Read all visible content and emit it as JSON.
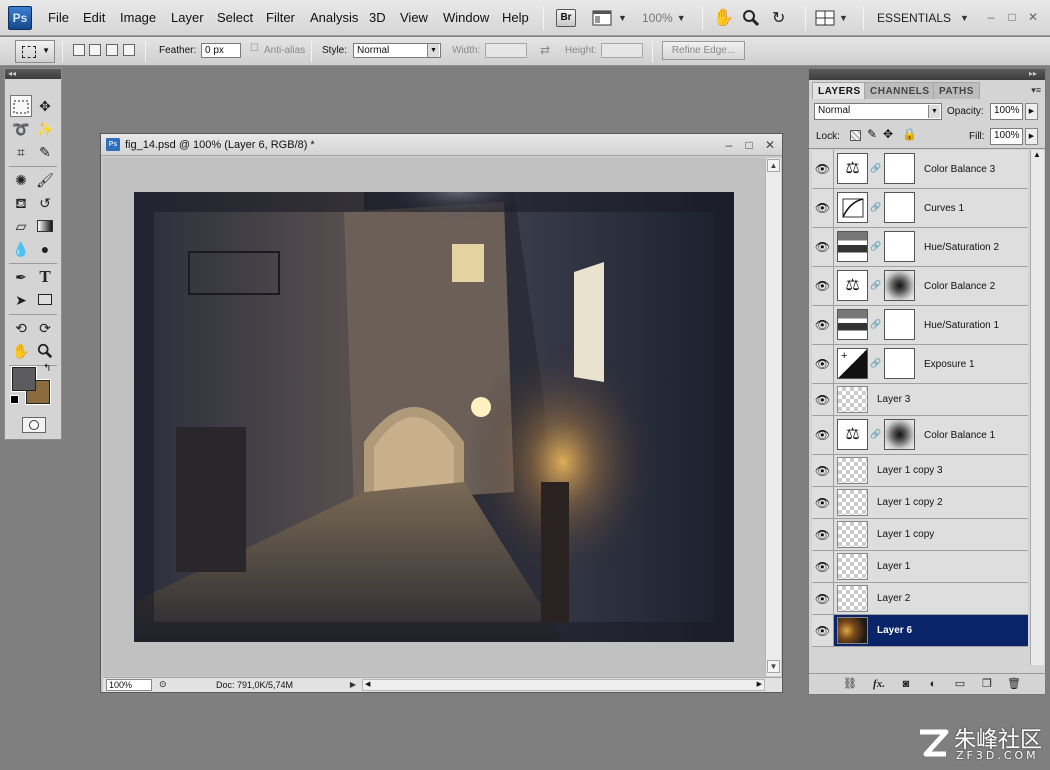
{
  "app": {
    "logo": "Ps"
  },
  "menubar": {
    "menus": [
      "File",
      "Edit",
      "Image",
      "Layer",
      "Select",
      "Filter",
      "Analysis",
      "3D",
      "View",
      "Window",
      "Help"
    ],
    "bridge_label": "Br",
    "zoom": "100%",
    "workspace": "ESSENTIALS",
    "icons": [
      "bridge-icon",
      "screen-mode-icon",
      "hand-icon",
      "zoom-icon",
      "rotate-view-icon",
      "arrange-documents-icon"
    ]
  },
  "options_bar": {
    "feather_label": "Feather:",
    "feather_value": "0 px",
    "antialias_label": "Anti-alias",
    "style_label": "Style:",
    "style_value": "Normal",
    "width_label": "Width:",
    "height_label": "Height:",
    "refine_edge_label": "Refine Edge..."
  },
  "tools": [
    "rectangular-marquee",
    "move",
    "lasso",
    "magic-wand",
    "crop",
    "eyedropper",
    "spot-healing-brush",
    "brush",
    "clone-stamp",
    "history-brush",
    "eraser",
    "gradient",
    "blur",
    "dodge",
    "pen",
    "type",
    "path-selection",
    "rectangle",
    "3d-rotate",
    "3d-orbit",
    "hand",
    "zoom"
  ],
  "colors": {
    "foreground": "#5c5c5e",
    "background": "#8a6a3e",
    "selected_layer": "#0a246a"
  },
  "document": {
    "title": "fig_14.psd @ 100% (Layer 6, RGB/8) *",
    "zoom": "100%",
    "doc_info": "Doc: 791,0K/5,74M"
  },
  "layers_panel": {
    "tabs": [
      "LAYERS",
      "CHANNELS",
      "PATHS"
    ],
    "blend_mode": "Normal",
    "opacity_label": "Opacity:",
    "opacity_value": "100%",
    "lock_label": "Lock:",
    "fill_label": "Fill:",
    "fill_value": "100%",
    "layers": [
      {
        "name": "Color Balance 3",
        "kind": "color-balance-adjustment",
        "mask": "white"
      },
      {
        "name": "Curves 1",
        "kind": "curves-adjustment",
        "mask": "white"
      },
      {
        "name": "Hue/Saturation 2",
        "kind": "hue-saturation-adjustment",
        "mask": "white"
      },
      {
        "name": "Color Balance 2",
        "kind": "color-balance-adjustment",
        "mask": "radial"
      },
      {
        "name": "Hue/Saturation 1",
        "kind": "hue-saturation-adjustment",
        "mask": "white"
      },
      {
        "name": "Exposure 1",
        "kind": "exposure-adjustment",
        "mask": "white"
      },
      {
        "name": "Layer 3",
        "kind": "pixel"
      },
      {
        "name": "Color Balance 1",
        "kind": "color-balance-adjustment",
        "mask": "radial"
      },
      {
        "name": "Layer 1 copy 3",
        "kind": "pixel"
      },
      {
        "name": "Layer 1 copy 2",
        "kind": "pixel"
      },
      {
        "name": "Layer 1 copy",
        "kind": "pixel"
      },
      {
        "name": "Layer 1",
        "kind": "pixel"
      },
      {
        "name": "Layer 2",
        "kind": "pixel"
      },
      {
        "name": "Layer 6",
        "kind": "image",
        "selected": true
      }
    ],
    "footer_icons": [
      "link-layers-icon",
      "layer-style-fx-icon",
      "add-mask-icon",
      "adjustment-layer-icon",
      "new-group-icon",
      "new-layer-icon",
      "trash-icon"
    ]
  },
  "watermark": {
    "text_zh": "朱峰社区",
    "domain": "ZF3D.COM"
  }
}
